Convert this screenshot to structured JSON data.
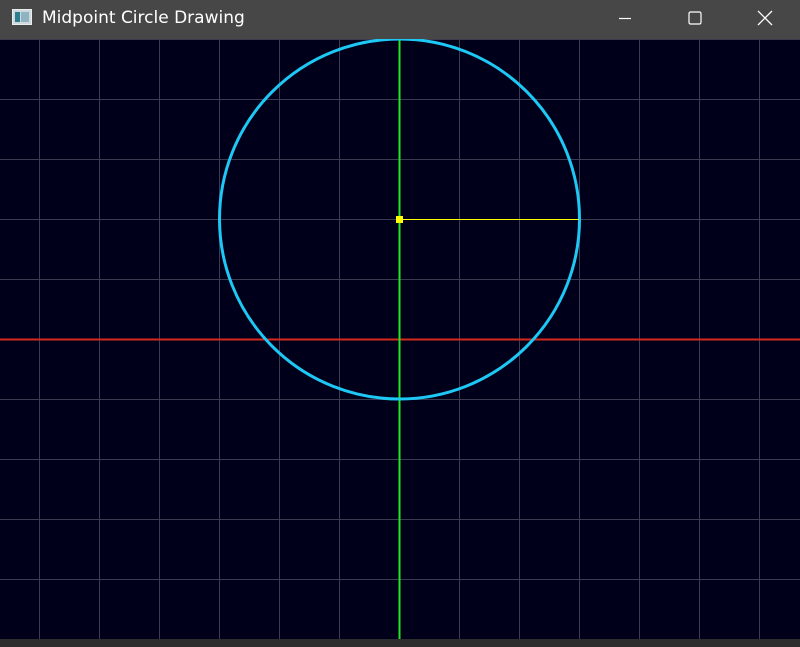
{
  "window": {
    "title": "Midpoint Circle Drawing",
    "controls": {
      "minimize_icon": "minimize-icon",
      "maximize_icon": "maximize-icon",
      "close_icon": "close-icon"
    }
  },
  "canvas": {
    "background_color": "#00001a",
    "grid": {
      "enabled": true,
      "color": "#3c3c50",
      "spacing": 60
    },
    "axes": {
      "x_axis_color": "#d42a1e",
      "y_axis_color": "#22e622"
    },
    "circle": {
      "center": [
        0,
        120
      ],
      "radius": 180,
      "color": "#1ec8f5"
    },
    "center_marker_color": "#ffff00",
    "radius_line_color": "#ffff00"
  }
}
